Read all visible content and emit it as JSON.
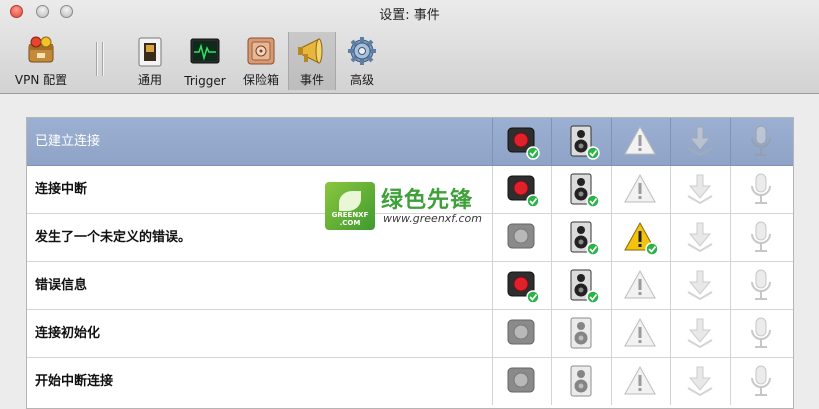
{
  "window": {
    "title": "设置: 事件"
  },
  "toolbar": {
    "items": [
      {
        "label": "VPN 配置",
        "icon": "vpn-config-icon"
      },
      {
        "label": "通用",
        "icon": "general-switch-icon"
      },
      {
        "label": "Trigger",
        "icon": "trigger-monitor-icon"
      },
      {
        "label": "保险箱",
        "icon": "safe-icon"
      },
      {
        "label": "事件",
        "icon": "megaphone-icon",
        "selected": true
      },
      {
        "label": "高级",
        "icon": "gear-icon"
      }
    ]
  },
  "columns": [
    "record-icon",
    "speaker-icon",
    "warning-icon",
    "growl-icon",
    "microphone-icon"
  ],
  "events": [
    {
      "label": "已建立连接",
      "selected": true,
      "states": [
        true,
        true,
        false,
        false,
        false
      ]
    },
    {
      "label": "连接中断",
      "states": [
        true,
        true,
        false,
        false,
        false
      ]
    },
    {
      "label": "发生了一个未定义的错误。",
      "states": [
        false,
        true,
        true,
        false,
        false
      ]
    },
    {
      "label": "错误信息",
      "states": [
        true,
        true,
        false,
        false,
        false
      ]
    },
    {
      "label": "连接初始化",
      "states": [
        false,
        false,
        false,
        false,
        false
      ]
    },
    {
      "label": "开始中断连接",
      "states": [
        false,
        false,
        false,
        false,
        false
      ]
    }
  ],
  "watermark": {
    "brand_small": "GREENXF\n.COM",
    "name": "绿色先锋",
    "url": "www.greenxf.com"
  },
  "colors": {
    "check": "#2bb34a",
    "record": "#e2202b",
    "warning": "#f2c40f",
    "selection": "#9cb0d2"
  }
}
